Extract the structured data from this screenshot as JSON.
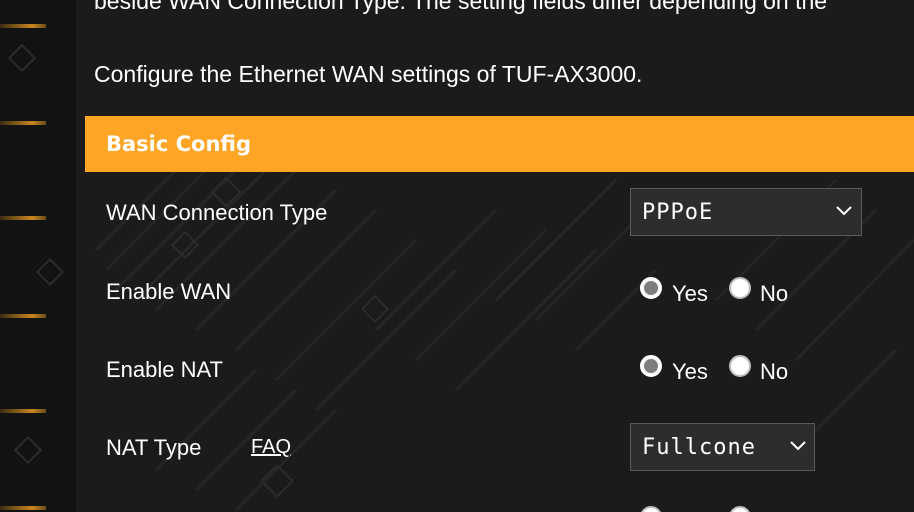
{
  "intro": {
    "cut_line": "beside WAN Connection Type. The setting fields differ depending on the",
    "configure_line": "Configure the Ethernet WAN settings of TUF-AX3000."
  },
  "section": {
    "title": "Basic Config"
  },
  "rows": {
    "wan_connection_type": {
      "label": "WAN Connection Type",
      "value": "PPPoE"
    },
    "enable_wan": {
      "label": "Enable WAN",
      "yes": "Yes",
      "no": "No",
      "selected": "Yes"
    },
    "enable_nat": {
      "label": "Enable NAT",
      "yes": "Yes",
      "no": "No",
      "selected": "Yes"
    },
    "nat_type": {
      "label": "NAT Type",
      "faq": "FAQ",
      "value": "Fullcone"
    }
  },
  "colors": {
    "accent": "#ffa526",
    "background": "#1b1b1b",
    "sidebar": "#121212",
    "sidebar_notch": "#c8861f"
  },
  "icons": {
    "select_arrow": "chevron-down-icon"
  }
}
